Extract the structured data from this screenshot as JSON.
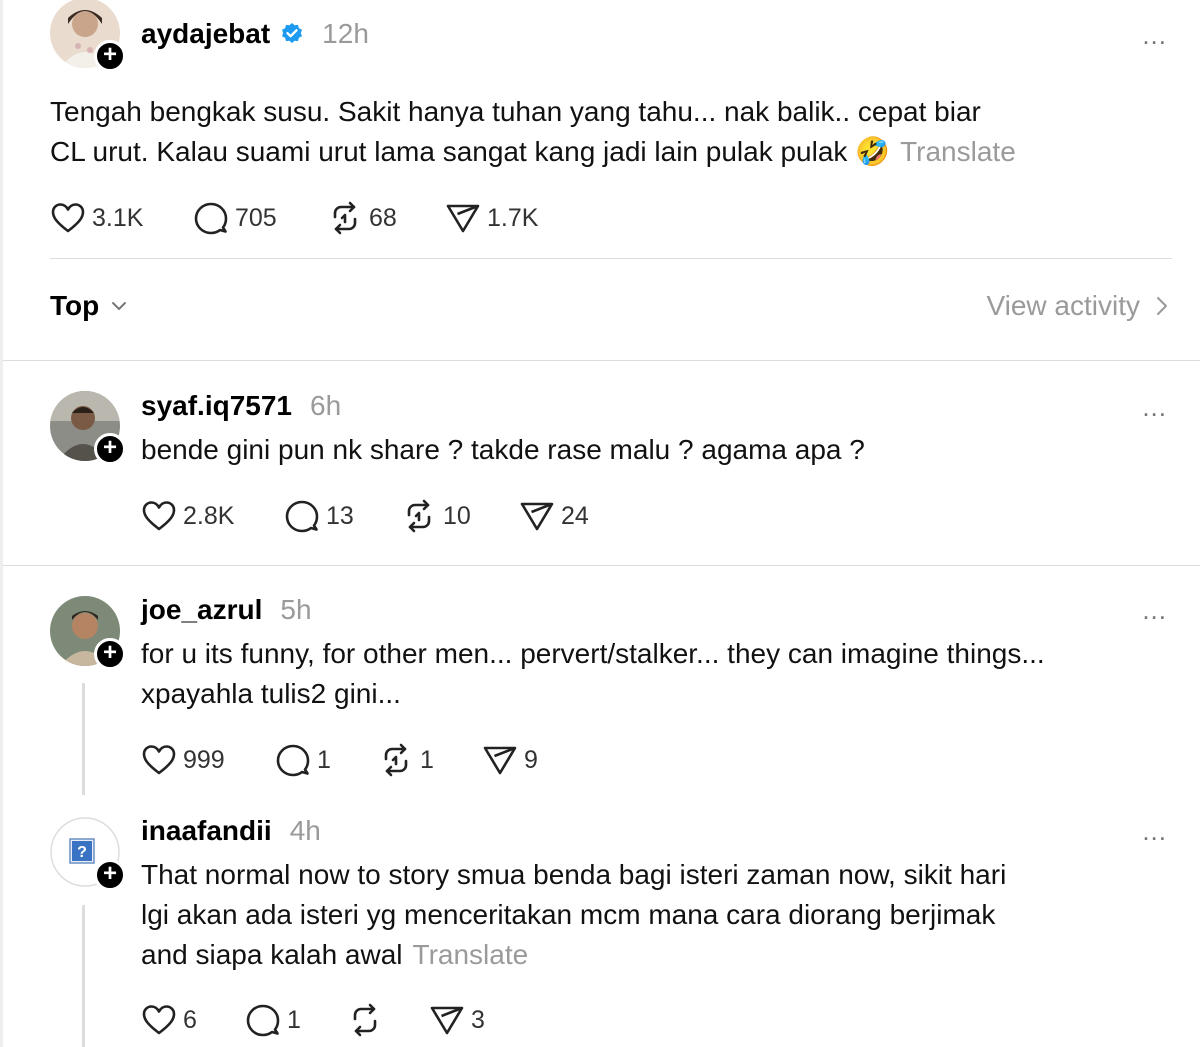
{
  "main_post": {
    "username": "aydajebat",
    "time": "12h",
    "text_line1": "Tengah bengkak susu. Sakit hanya tuhan yang tahu... nak balik.. cepat biar",
    "text_line2": "CL urut. Kalau suami urut lama sangat kang jadi lain pulak pulak",
    "emoji": "🤣",
    "translate": "Translate",
    "likes": "3.1K",
    "replies": "705",
    "reposts": "68",
    "shares": "1.7K",
    "more": "..."
  },
  "sort": {
    "label": "Top",
    "view_activity": "View activity"
  },
  "replies": [
    {
      "username": "syaf.iq7571",
      "time": "6h",
      "text": "bende gini pun nk share ? takde rase malu ? agama apa ?",
      "likes": "2.8K",
      "replies": "13",
      "reposts": "10",
      "shares": "24",
      "more": "..."
    },
    {
      "username": "joe_azrul",
      "time": "5h",
      "text_line1": "for u its funny, for other men... pervert/stalker... they can imagine things...",
      "text_line2": "xpayahla tulis2 gini...",
      "likes": "999",
      "replies": "1",
      "reposts": "1",
      "shares": "9",
      "more": "..."
    },
    {
      "username": "inaafandii",
      "time": "4h",
      "text_line1": "That normal now to story smua benda bagi isteri zaman now, sikit hari",
      "text_line2": "lgi akan ada isteri yg menceritakan mcm mana cara diorang berjimak",
      "text_line3": "and siapa kalah awal",
      "translate": "Translate",
      "likes": "6",
      "replies": "1",
      "reposts": "",
      "shares": "3",
      "more": "..."
    }
  ],
  "colors": {
    "verified": "#1d9bf0",
    "muted": "#9a9a9a",
    "divider": "#dcdcdc"
  }
}
